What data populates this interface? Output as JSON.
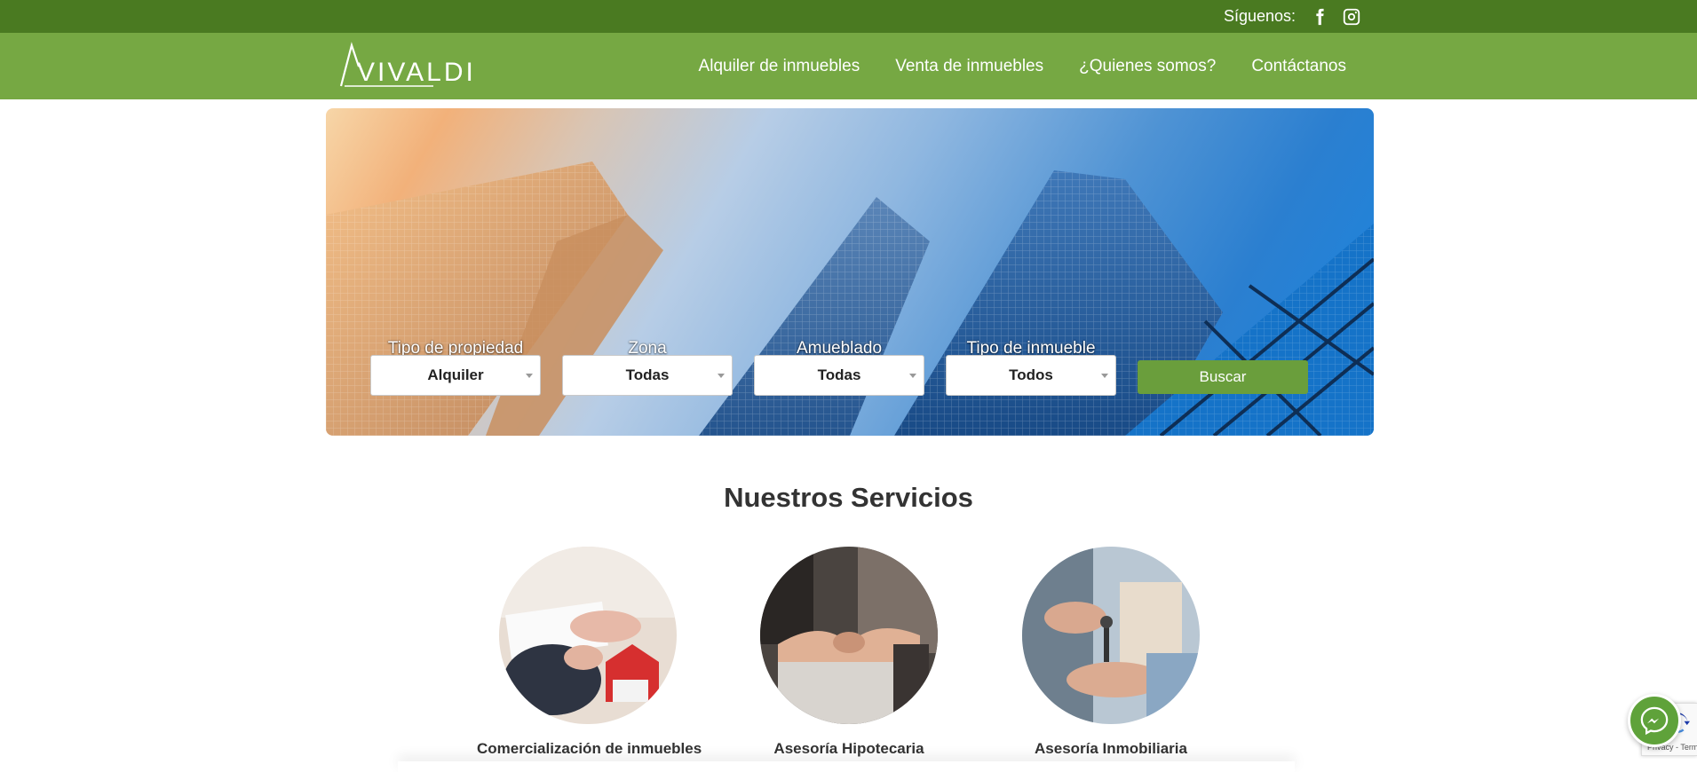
{
  "topbar": {
    "follow_label": "Síguenos:",
    "social": [
      {
        "icon": "facebook-icon"
      },
      {
        "icon": "instagram-icon"
      }
    ]
  },
  "brand": {
    "logo_text": "VIVALDI"
  },
  "nav": {
    "items": [
      {
        "label": "Alquiler de inmuebles"
      },
      {
        "label": "Venta de inmuebles"
      },
      {
        "label": "¿Quienes somos?"
      },
      {
        "label": "Contáctanos"
      }
    ]
  },
  "search": {
    "filters": [
      {
        "label": "Tipo de propiedad",
        "value": "Alquiler"
      },
      {
        "label": "Zona",
        "value": "Todas"
      },
      {
        "label": "Amueblado",
        "value": "Todas"
      },
      {
        "label": "Tipo de inmueble",
        "value": "Todos"
      }
    ],
    "button_label": "Buscar"
  },
  "services": {
    "title": "Nuestros Servicios",
    "items": [
      {
        "title": "Comercialización de inmuebles"
      },
      {
        "title": "Asesoría Hipotecaria"
      },
      {
        "title": "Asesoría Inmobiliaria"
      }
    ]
  },
  "recaptcha": {
    "text": "Privacy - Terms"
  },
  "colors": {
    "topbar": "#4a7a21",
    "navbar": "#76a843",
    "button": "#6a9e3c"
  }
}
